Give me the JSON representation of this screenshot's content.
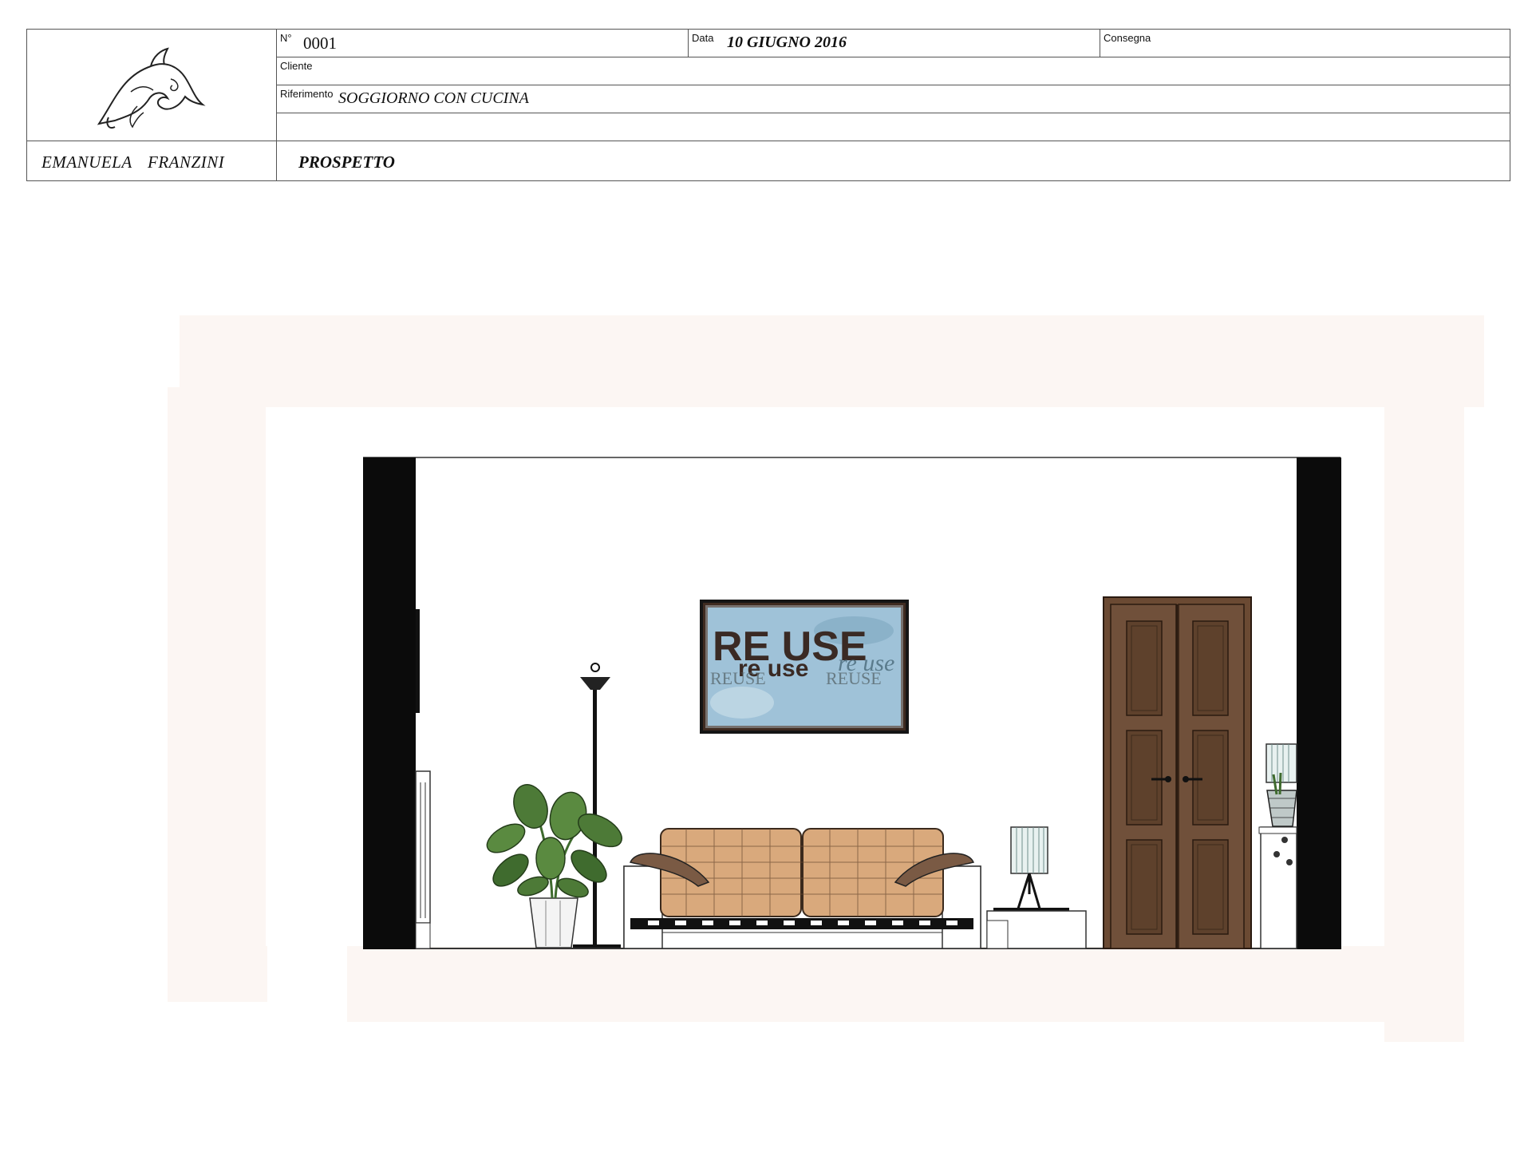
{
  "title_block": {
    "number_label": "N°",
    "number_value": "0001",
    "date_label": "Data",
    "date_value": "10 GIUGNO 2016",
    "delivery_label": "Consegna",
    "delivery_value": "",
    "client_label": "Cliente",
    "client_value": "",
    "reference_label": "Riferimento",
    "reference_value": "SOGGIORNO CON CUCINA",
    "author": "EMANUELA FRANZINI",
    "view_title": "PROSPETTO"
  },
  "artwork": {
    "line1": "RE USE",
    "line2": "re use",
    "line3a": "REUSE",
    "line3b": "REUSE",
    "script": "re use"
  },
  "colors": {
    "wall_dark": "#0b0b0b",
    "door_wood": "#6b4a33",
    "sofa_fabric": "#d9a97c",
    "plant_green": "#3f6b2e",
    "art_blue": "#9fc2d8",
    "border_glow": "#fbf4f1"
  }
}
